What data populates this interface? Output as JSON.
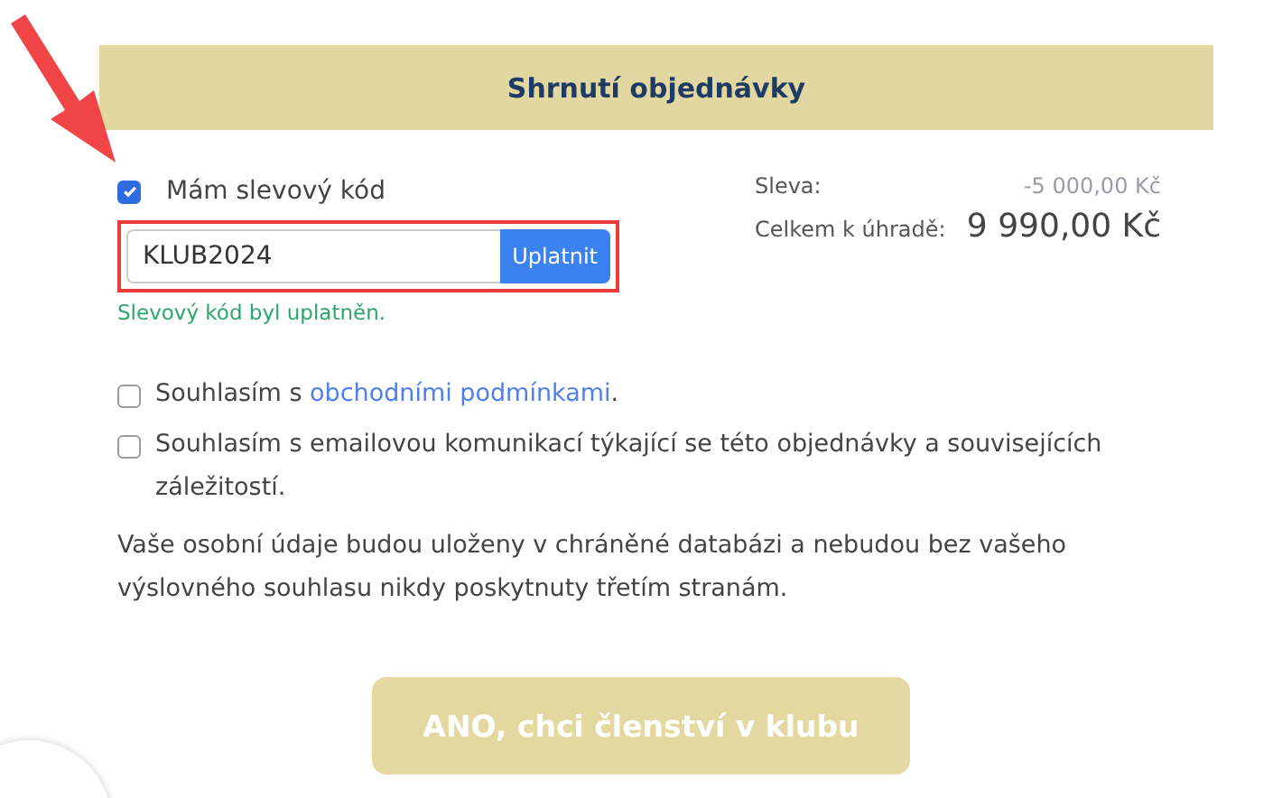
{
  "header": {
    "title": "Shrnutí objednávky"
  },
  "discount": {
    "label": "Mám slevový kód",
    "checked": true,
    "code": "KLUB2024",
    "apply_button": "Uplatnit",
    "highlighted": true,
    "message": "Slevový kód byl uplatněn."
  },
  "summary": [
    {
      "label": "Sleva:",
      "value": "-5 000,00 Kč",
      "kind": "discount"
    },
    {
      "label": "Celkem k úhradě:",
      "value": "9 990,00 Kč",
      "kind": "total"
    }
  ],
  "consents": [
    {
      "prefix": "Souhlasím s ",
      "link": "obchodními podmínkami",
      "suffix": ".",
      "checked": false
    },
    {
      "prefix": "Souhlasím s emailovou komunikací týkající se této objednávky a souvisejících záležitostí.",
      "checked": false
    }
  ],
  "privacy_note": "Vaše osobní údaje budou uloženy v chráněné databázi a nebudou bez vašeho výslovného souhlasu nikdy poskytnuty třetím stranám.",
  "submit_button": {
    "label": "ANO, chci členství v klubu",
    "disabled": true
  }
}
